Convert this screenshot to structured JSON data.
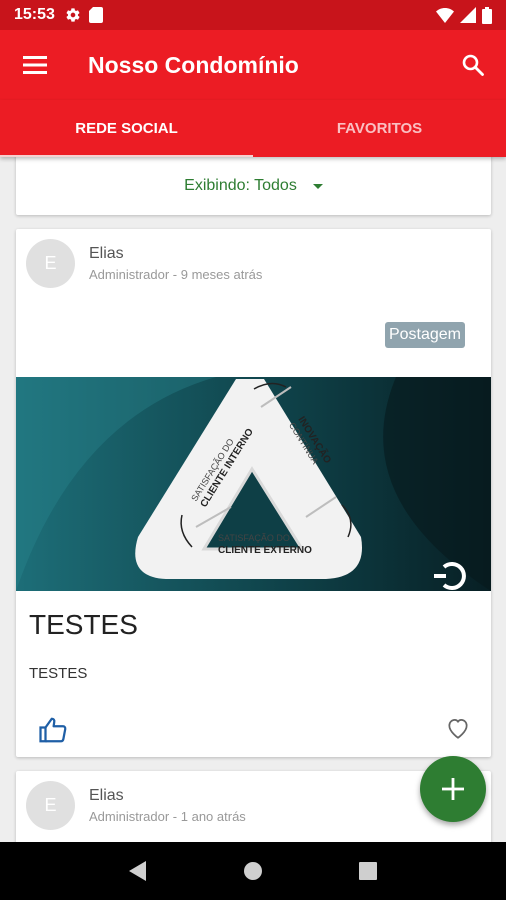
{
  "status_bar": {
    "time": "15:53",
    "left_icons": [
      "gear-icon",
      "sd-card-icon"
    ],
    "right_icons": [
      "wifi-icon",
      "signal-icon",
      "battery-icon"
    ]
  },
  "app_bar": {
    "title": "Nosso Condomínio",
    "color": "#ec1c24"
  },
  "tabs": [
    {
      "label": "REDE SOCIAL",
      "active": true
    },
    {
      "label": "FAVORITOS",
      "active": false
    }
  ],
  "filter": {
    "label": "Exibindo: Todos"
  },
  "posts": [
    {
      "avatar_letter": "E",
      "author": "Elias",
      "meta": "Administrador - 9 meses atrás",
      "badge": "Postagem",
      "image": {
        "inner_label_1_small": "SATISFAÇÃO DO",
        "inner_label_1_bold": "CLIENTE INTERNO",
        "inner_label_2_bold": "INOVAÇÃO",
        "inner_label_2_small": "CONTÍNUA",
        "inner_label_3_small": "SATISFAÇÃO DO",
        "inner_label_3_bold": "CLIENTE EXTERNO"
      },
      "title": "TESTES",
      "body": "TESTES"
    },
    {
      "avatar_letter": "E",
      "author": "Elias",
      "meta": "Administrador - 1 ano atrás"
    }
  ],
  "fab": {
    "icon": "plus-icon",
    "color": "#2e7d32"
  },
  "nav": [
    "back-icon",
    "home-icon",
    "recents-icon"
  ]
}
